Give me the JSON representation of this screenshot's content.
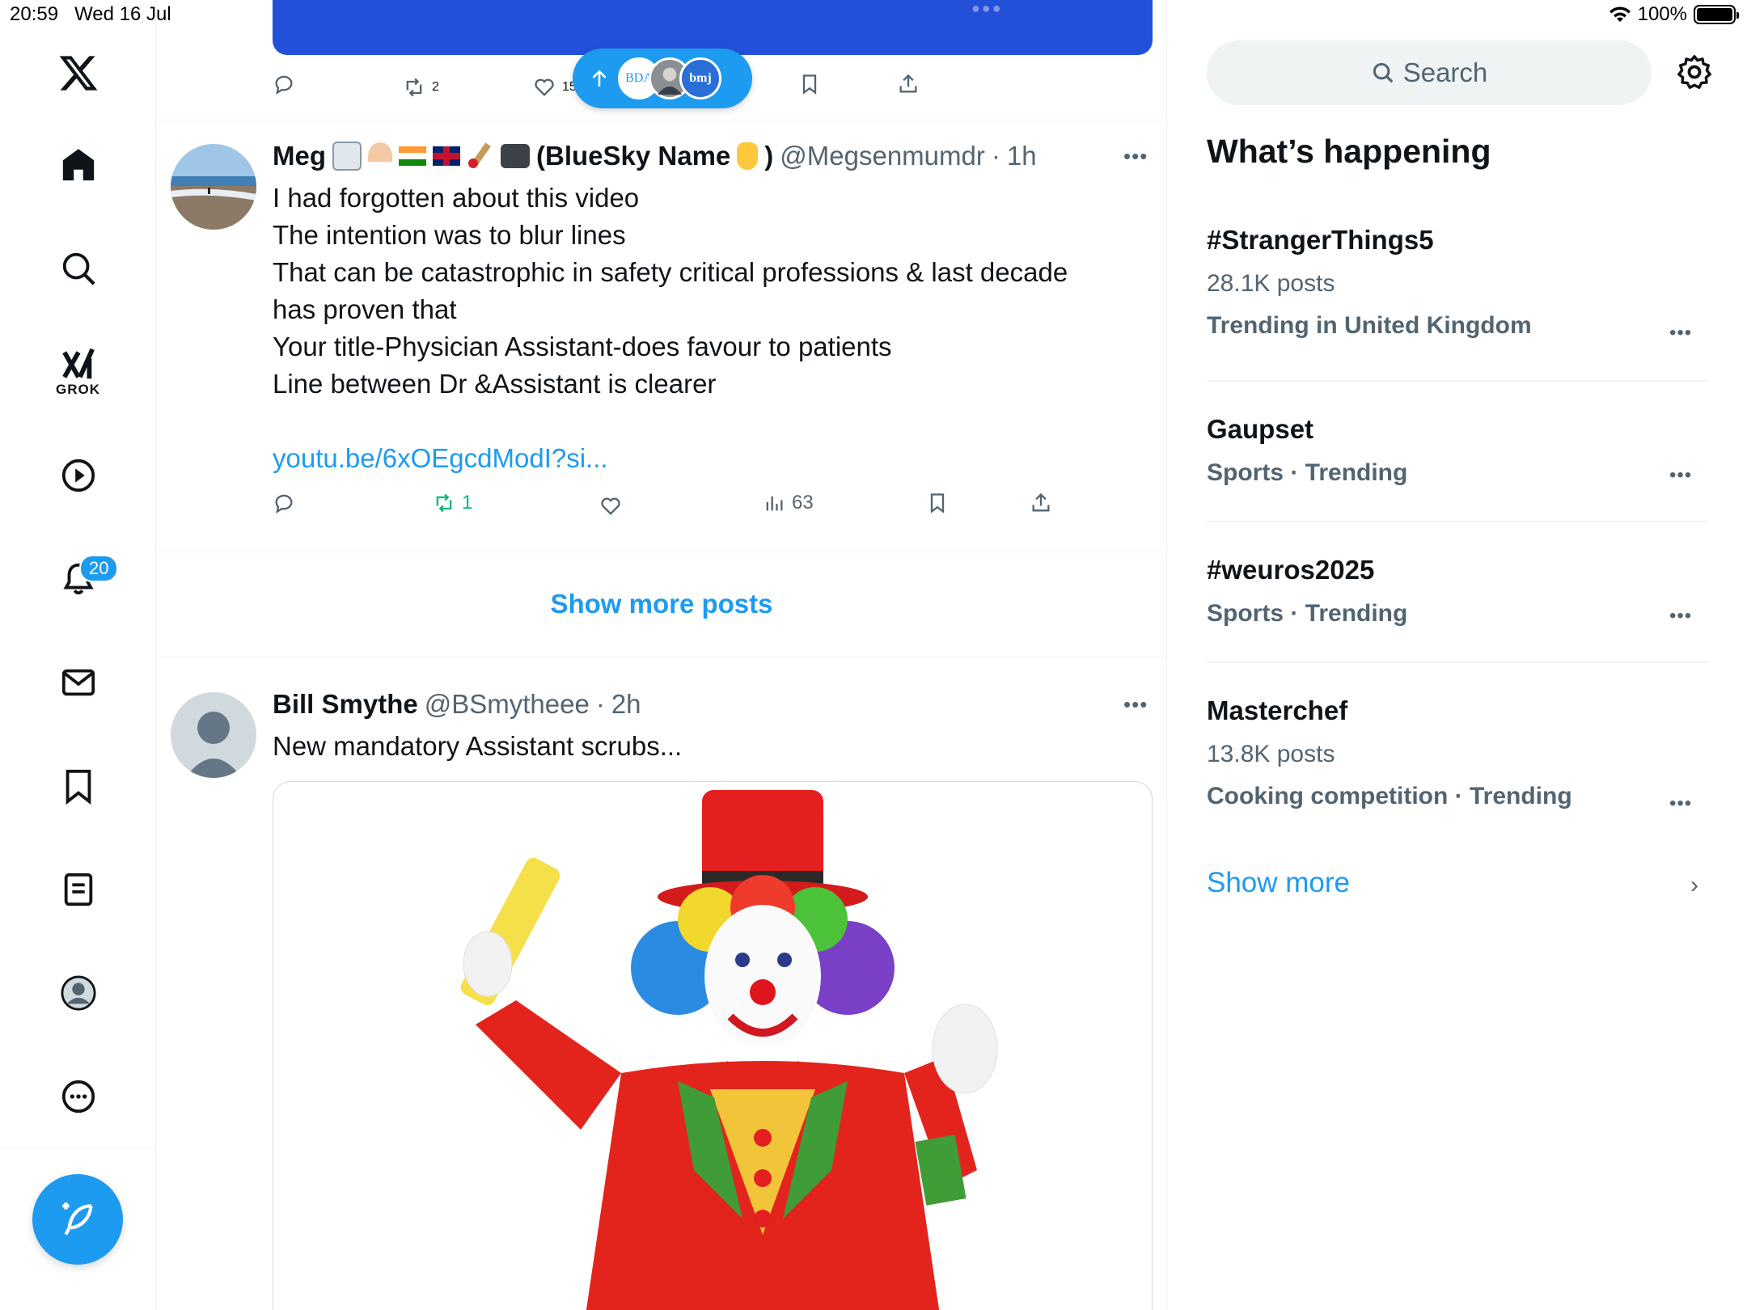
{
  "status": {
    "time": "20:59",
    "date": "Wed 16 Jul",
    "battery": "100%"
  },
  "nav": {
    "items": [
      {
        "name": "home"
      },
      {
        "name": "explore"
      },
      {
        "name": "grok",
        "label": "GROK"
      },
      {
        "name": "videos"
      },
      {
        "name": "notifications",
        "badge": "20"
      },
      {
        "name": "messages"
      },
      {
        "name": "bookmarks"
      },
      {
        "name": "lists"
      },
      {
        "name": "profile"
      },
      {
        "name": "more"
      }
    ]
  },
  "feed": {
    "top_tweet_actions": {
      "reposts": "2",
      "likes": "15"
    },
    "tweet1": {
      "name": "Meg",
      "display_suffix": "(BlueSky Name",
      "handle": "@Megsenmumdr",
      "time": "1h",
      "lines": [
        "I had forgotten about this video",
        "The intention was to blur lines",
        "That can be catastrophic in safety critical professions & last decade",
        "has proven that",
        "Your title-Physician Assistant-does favour to patients",
        "Line between Dr &Assistant is clearer"
      ],
      "link": "youtu.be/6xOEgcdModI?si...",
      "reposts": "1",
      "views": "63"
    },
    "show_more_posts": "Show more posts",
    "tweet2": {
      "name": "Bill Smythe",
      "handle": "@BSmytheee",
      "time": "2h",
      "text": "New mandatory Assistant scrubs..."
    }
  },
  "pill": {
    "labels": [
      "BDA",
      "bmj"
    ]
  },
  "sidebar": {
    "search_placeholder": "Search",
    "title": "What’s happening",
    "trends": [
      {
        "name": "#StrangerThings5",
        "posts": "28.1K posts",
        "context": "Trending in United Kingdom"
      },
      {
        "name": "Gaupset",
        "context": "Sports · Trending"
      },
      {
        "name": "#weuros2025",
        "context": "Sports · Trending"
      },
      {
        "name": "Masterchef",
        "posts": "13.8K posts",
        "context": "Cooking competition · Trending"
      }
    ],
    "show_more": "Show more"
  },
  "colors": {
    "accent": "#1d9bf0",
    "text": "#0f1419",
    "muted": "#536471",
    "repost_active": "#00ba7c"
  }
}
